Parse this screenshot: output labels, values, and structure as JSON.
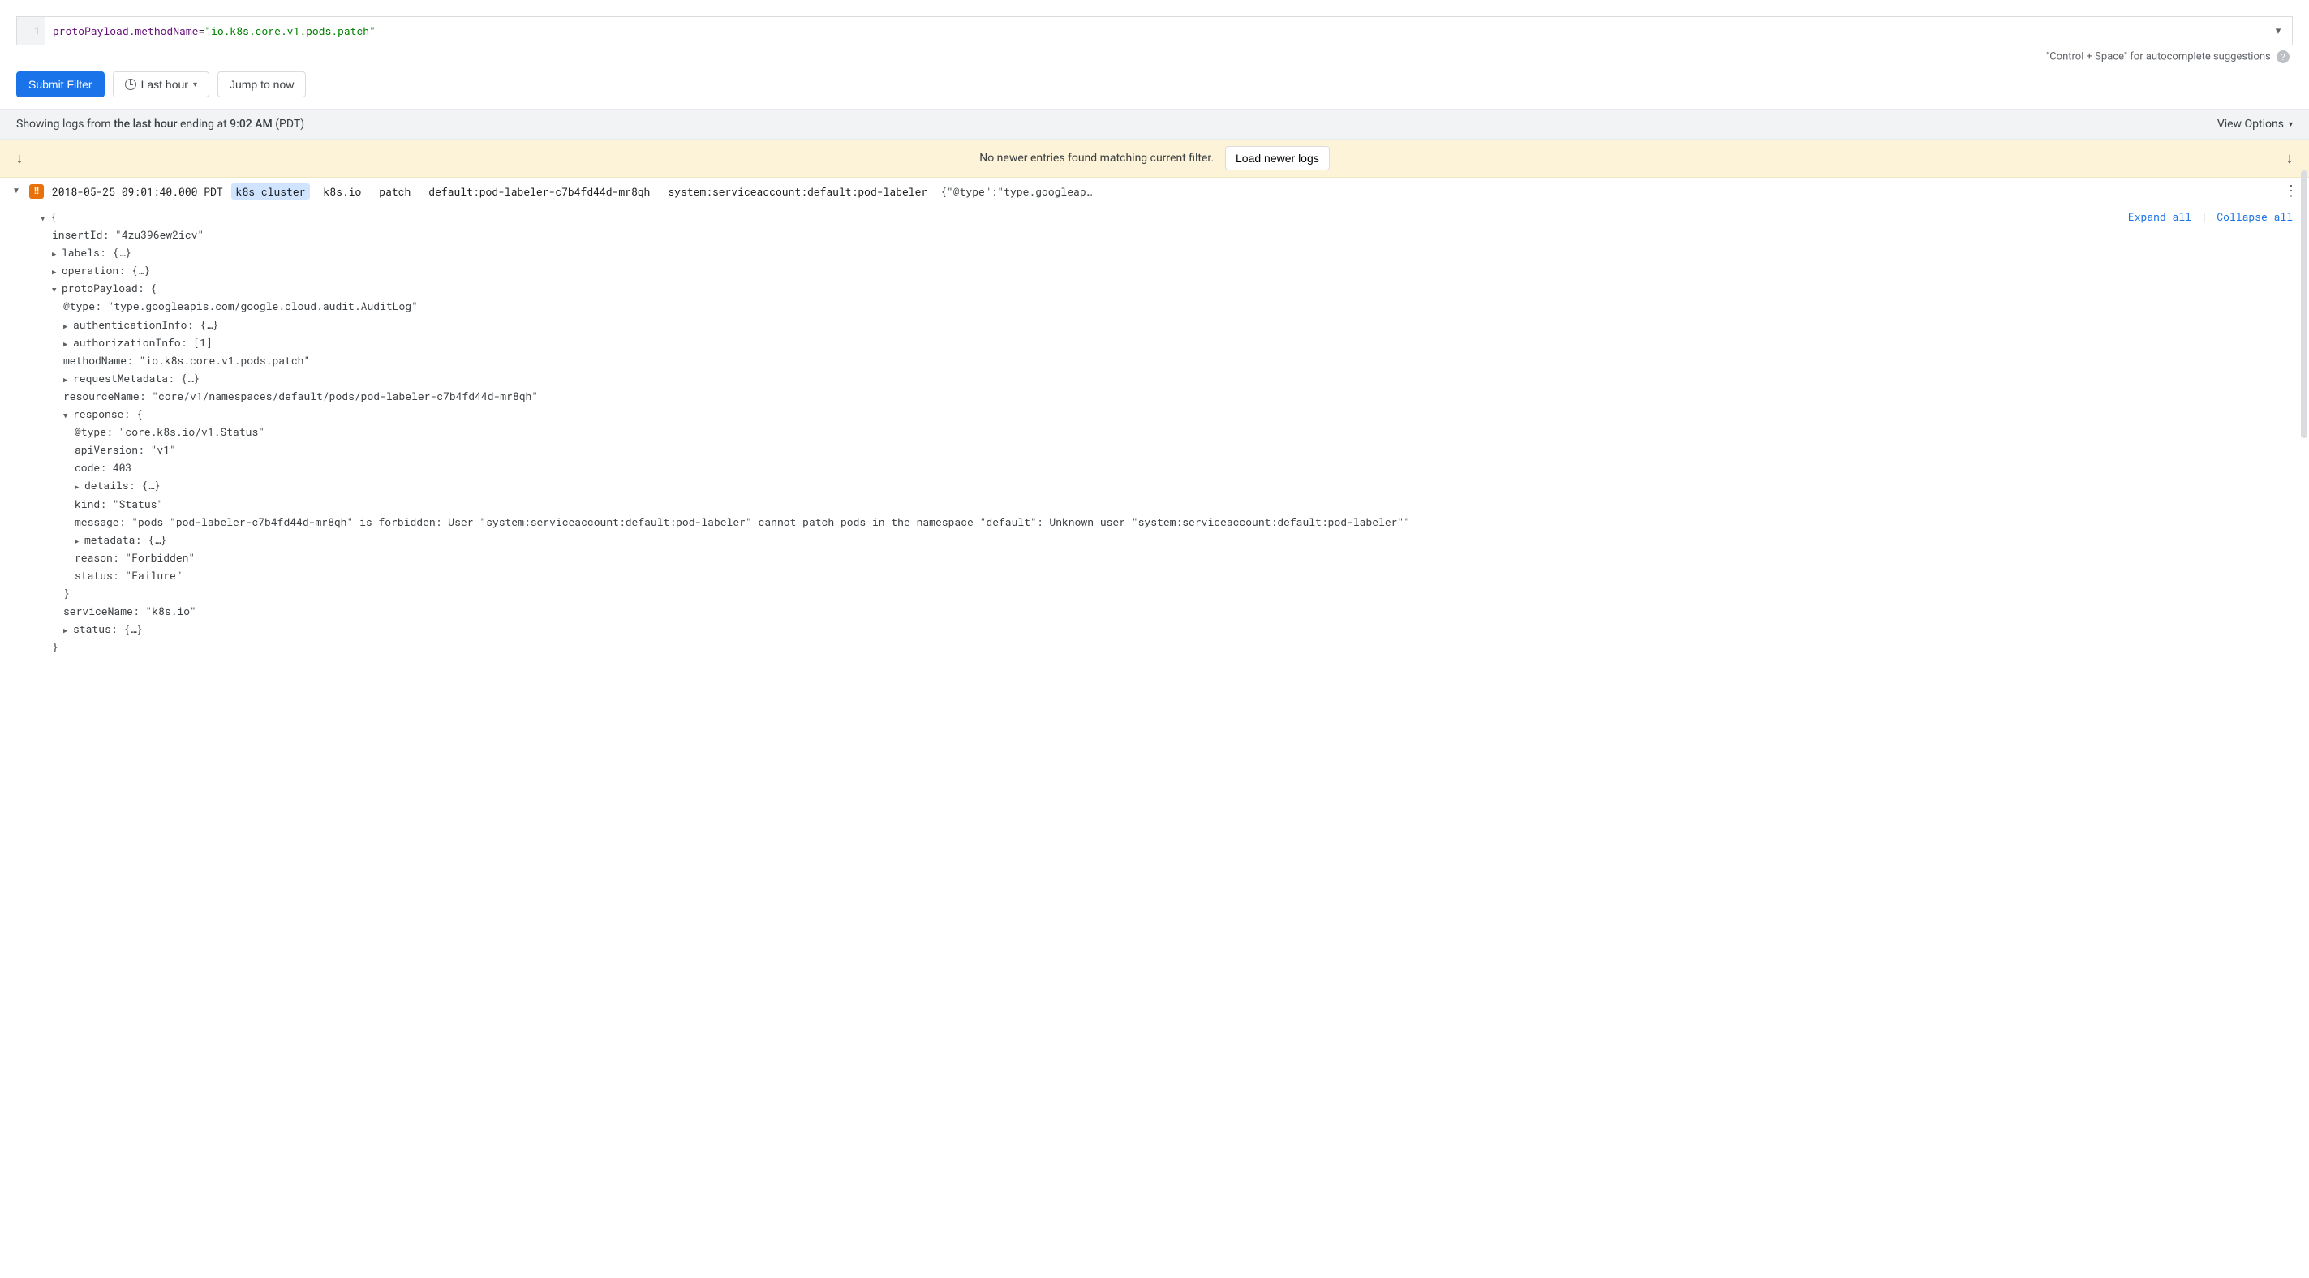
{
  "query": {
    "line_number": "1",
    "key": "protoPayload.methodName",
    "op": "=",
    "value": "\"io.k8s.core.v1.pods.patch\""
  },
  "hint": {
    "text": "\"Control + Space\" for autocomplete suggestions"
  },
  "toolbar": {
    "submit": "Submit Filter",
    "timerange": "Last hour",
    "jump": "Jump to now"
  },
  "status": {
    "prefix": "Showing logs from ",
    "range": "the last hour",
    "mid": " ending at ",
    "time": "9:02 AM",
    "tz": " (PDT)",
    "view_options": "View Options"
  },
  "loadbar": {
    "msg": "No newer entries found matching current filter.",
    "btn": "Load newer logs"
  },
  "logrow": {
    "timestamp": "2018-05-25 09:01:40.000 PDT",
    "tag_cluster": "k8s_cluster",
    "tag_service": "k8s.io",
    "tag_verb": "patch",
    "tag_resource": "default:pod-labeler-c7b4fd44d-mr8qh",
    "tag_principal": "system:serviceaccount:default:pod-labeler",
    "tag_json": "{\"@type\":\"type.googleap…"
  },
  "actions": {
    "expand": "Expand all",
    "collapse": "Collapse all"
  },
  "json": {
    "open": "{",
    "insertId_k": "insertId:",
    "insertId_v": " \"4zu396ew2icv\"",
    "labels": "labels: {…}",
    "operation": "operation: {…}",
    "proto_open": "protoPayload: {",
    "p_type_k": "@type:",
    "p_type_v": " \"type.googleapis.com/google.cloud.audit.AuditLog\"",
    "authn": "authenticationInfo: {…}",
    "authz": "authorizationInfo: [1]",
    "method_k": "methodName:",
    "method_v": " \"io.k8s.core.v1.pods.patch\"",
    "reqmeta": "requestMetadata: {…}",
    "resname_k": "resourceName:",
    "resname_v": " \"core/v1/namespaces/default/pods/pod-labeler-c7b4fd44d-mr8qh\"",
    "resp_open": "response: {",
    "r_type_k": "@type:",
    "r_type_v": " \"core.k8s.io/v1.Status\"",
    "r_api_k": "apiVersion:",
    "r_api_v": " \"v1\"",
    "r_code_k": "code:",
    "r_code_v": " 403",
    "r_details": "details: {…}",
    "r_kind_k": "kind:",
    "r_kind_v": " \"Status\"",
    "r_msg_k": "message:",
    "r_msg_v": " \"pods \"pod-labeler-c7b4fd44d-mr8qh\" is forbidden: User \"system:serviceaccount:default:pod-labeler\" cannot patch pods in the namespace \"default\": Unknown user \"system:serviceaccount:default:pod-labeler\"\"",
    "r_meta": "metadata: {…}",
    "r_reason_k": "reason:",
    "r_reason_v": " \"Forbidden\"",
    "r_status_k": "status:",
    "r_status_v": " \"Failure\"",
    "brace_close": "}",
    "svc_k": "serviceName:",
    "svc_v": " \"k8s.io\"",
    "status_coll": "status: {…}"
  }
}
